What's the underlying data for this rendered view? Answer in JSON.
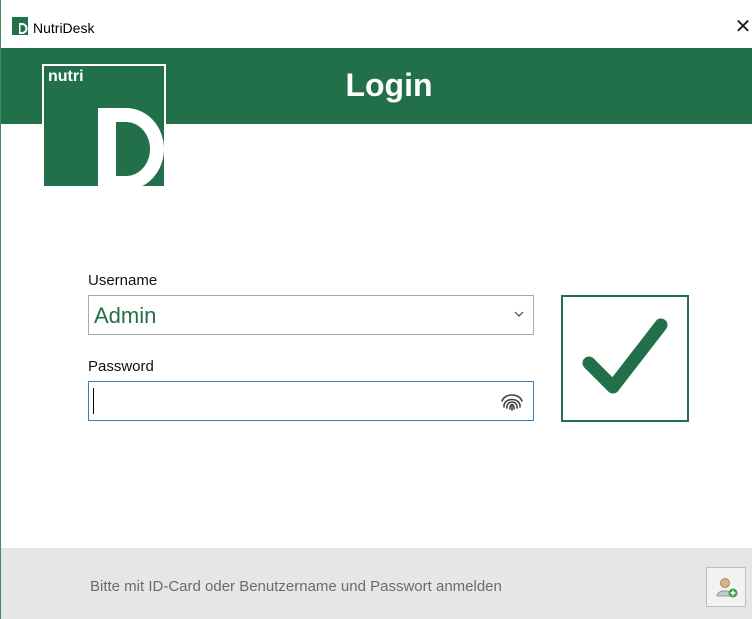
{
  "window": {
    "title": "NutriDesk"
  },
  "header": {
    "title": "Login"
  },
  "logo": {
    "text": "nutri",
    "letter": "D"
  },
  "form": {
    "username_label": "Username",
    "username_value": "Admin",
    "password_label": "Password",
    "password_value": ""
  },
  "footer": {
    "hint": "Bitte mit ID-Card oder Benutzername und Passwort anmelden"
  },
  "icons": {
    "app": "nutridesk-app-icon",
    "close": "close-icon",
    "dropdown": "chevron-down-icon",
    "fingerprint": "fingerprint-icon",
    "confirm": "checkmark-icon",
    "add_user": "add-user-icon"
  },
  "colors": {
    "brand_green": "#22704a",
    "footer_bg": "#e6e6e6",
    "focus_border": "#3c7fb1"
  }
}
